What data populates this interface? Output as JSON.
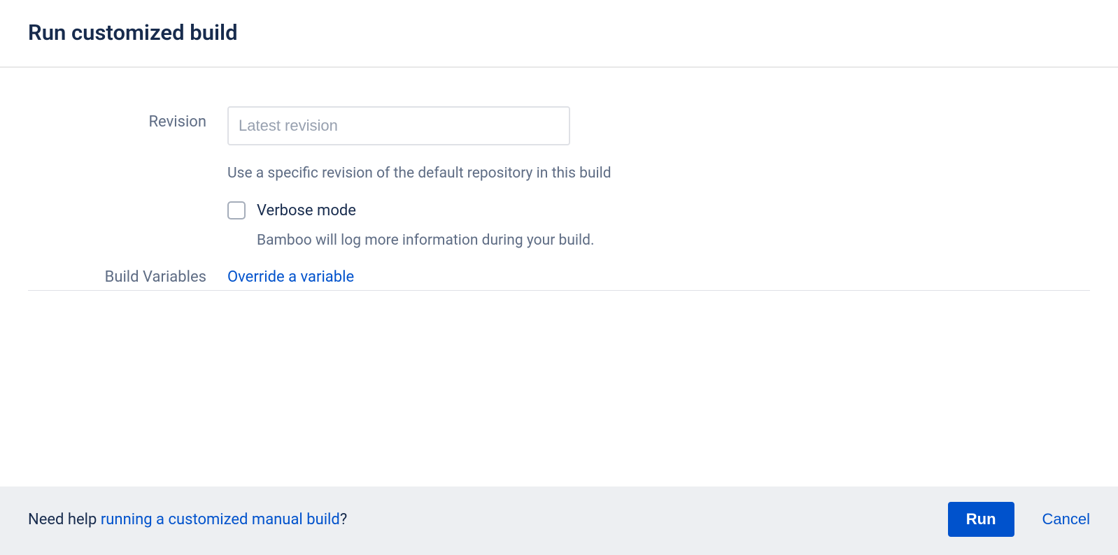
{
  "header": {
    "title": "Run customized build"
  },
  "form": {
    "revision": {
      "label": "Revision",
      "placeholder": "Latest revision",
      "value": "",
      "help": "Use a specific revision of the default repository in this build"
    },
    "verbose": {
      "label": "Verbose mode",
      "help": "Bamboo will log more information during your build."
    },
    "variables": {
      "label": "Build Variables",
      "link": "Override a variable"
    }
  },
  "footer": {
    "help_prefix": "Need help ",
    "help_link": "running a customized manual build",
    "help_suffix": "?",
    "run": "Run",
    "cancel": "Cancel"
  }
}
